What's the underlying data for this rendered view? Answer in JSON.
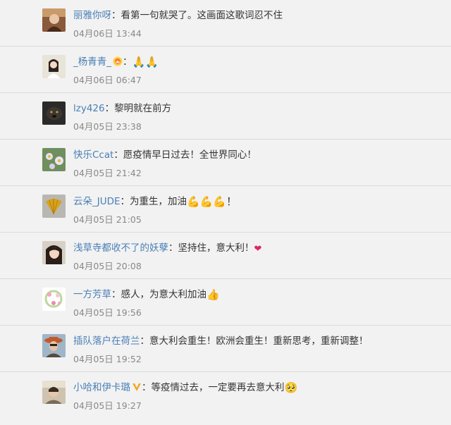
{
  "comments": [
    {
      "user": "丽雅你呀",
      "text": "看第一句就哭了。这画面这歌词忍不住",
      "emoji": "",
      "time": "04月06日 13:44"
    },
    {
      "user": "_杨青青_",
      "text": "",
      "emoji": "🙏🙏",
      "time": "04月06日 06:47"
    },
    {
      "user": "lzy426",
      "text": "黎明就在前方",
      "emoji": "",
      "time": "04月05日 23:38"
    },
    {
      "user": "快乐Ccat",
      "text": "愿疫情早日过去！全世界同心！",
      "emoji": "",
      "time": "04月05日 21:42"
    },
    {
      "user": "云朵_JUDE",
      "text": "为重生，加油",
      "emoji": "💪💪💪！",
      "time": "04月05日 21:05"
    },
    {
      "user": "浅草寺都收不了的妖孽",
      "text": "坚持住，意大利！",
      "emoji": "❤",
      "time": "04月05日 20:08"
    },
    {
      "user": "一方芳草",
      "text": "感人，为意大利加油",
      "emoji": "👍",
      "time": "04月05日 19:56"
    },
    {
      "user": "插队落户在荷兰",
      "text": "意大利会重生！欧洲会重生！重新思考，重新调整！",
      "emoji": "",
      "time": "04月05日 19:52"
    },
    {
      "user": "小哈和伊卡璐",
      "text": "等疫情过去，一定要再去意大利",
      "emoji": "🥺",
      "time": "04月05日 19:27"
    }
  ],
  "separator": "：",
  "colors": {
    "username": "#4a7fb5",
    "text": "#333333",
    "time": "#888888",
    "background": "#f2f2f2",
    "divider": "#dadada"
  }
}
